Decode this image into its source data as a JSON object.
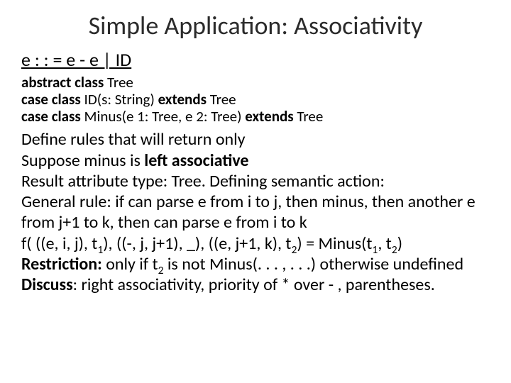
{
  "title": "Simple Application: Associativity",
  "grammar": "e : : = e - e | ID",
  "code": {
    "l1a": "abstract class",
    "l1b": " Tree",
    "l2a": "case class",
    "l2b": " ID(s: String) ",
    "l2c": "extends",
    "l2d": " Tree",
    "l3a": "case class",
    "l3b": " Minus(e 1: Tree, e 2: Tree) ",
    "l3c": "extends",
    "l3d": " Tree"
  },
  "body": {
    "p1": "Define rules that will return only",
    "p2a": "Suppose minus is ",
    "p2b": "left associative",
    "p3": "Result attribute type: Tree. Defining semantic action:",
    "p4": "General rule: if can parse e from i to j, then minus, then another e from j+1 to k, then can parse e from i to k",
    "p5a": "f( ",
    "p5b": "((e, i, j), t",
    "p5c": ")",
    "p5d": ",  ",
    "p5e": "((-, j, j+1), _)",
    "p5f": ", ",
    "p5g": "((e, j+1, k), t",
    "p5h": ")",
    "p5i": " = Minus(t",
    "p5j": ", t",
    "p5k": ")",
    "p6a": "Restriction:",
    "p6b": "  only if t",
    "p6c": " is not Minus(. . . , . . .) otherwise undefined",
    "p7a": "Discuss",
    "p7b": ": right associativity, priority of * over - , parentheses.",
    "one": "1",
    "two": "2"
  }
}
